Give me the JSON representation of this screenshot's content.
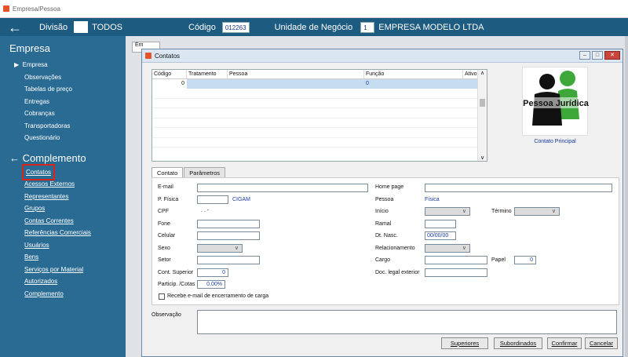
{
  "window": {
    "title": "Empresa/Pessoa"
  },
  "topbar": {
    "divisao_label": "Divisão",
    "divisao_value": "TODOS",
    "codigo_label": "Código",
    "codigo_value": "012263",
    "unidade_label": "Unidade de Negócio",
    "unidade_code": "1",
    "unidade_name": "EMPRESA MODELO LTDA"
  },
  "sidebar": {
    "section1": "Empresa",
    "items": [
      "Empresa",
      "Observações",
      "Tabelas de preço",
      "Entregas",
      "Cobranças",
      "Transportadoras",
      "Questionário"
    ],
    "section2": "Complemento",
    "links": [
      "Contatos",
      "Acessos Externos",
      "Representantes",
      "Grupos",
      "Contas Correntes",
      "Referências Comerciais",
      "Usuários",
      "Bens",
      "Serviços por Material",
      "Autorizados",
      "Complemento"
    ]
  },
  "bg_tab": "Em",
  "dialog": {
    "title": "Contatos",
    "grid": {
      "columns": [
        "Código",
        "Tratamento",
        "Pessoa",
        "Função",
        "Ativo"
      ],
      "row": {
        "codigo": "0",
        "funcao": "0"
      }
    },
    "photo_text": "Pessoa Jurídica",
    "photo_caption": "Contato Principal",
    "tabs": [
      "Contato",
      "Parâmetros"
    ],
    "form": {
      "email": "E-mail",
      "homepage": "Home page",
      "pfisica": "P. Física",
      "pfisica_value": "CIGAM",
      "pessoa": "Pessoa",
      "pessoa_value": "Física",
      "cpf": "CPF",
      "cpf_value": ". . -",
      "inicio": "Início",
      "termino": "Término",
      "fone": "Fone",
      "ramal": "Ramal",
      "celular": "Celular",
      "dtnasc": "Dt. Nasc.",
      "dtnasc_value": "00/00/00",
      "sexo": "Sexo",
      "relacionamento": "Relacionamento",
      "setor": "Setor",
      "cargo": "Cargo",
      "papel": "Papel",
      "papel_value": "0",
      "contsuperior": "Cont. Superior",
      "contsuperior_value": "0",
      "doclegal": "Doc. legal exterior",
      "particip": "Particip. /Cotas",
      "particip_value": "0,00%",
      "recebe": "Recebe e-mail de encerramento de carga"
    },
    "observacao": "Observação",
    "buttons": [
      "Superiores",
      "Subordinados",
      "Confirmar",
      "Cancelar"
    ]
  },
  "colors": {
    "sidebar": "#2a6b93",
    "topbar": "#1e5b80",
    "highlight": "#d9261c"
  }
}
